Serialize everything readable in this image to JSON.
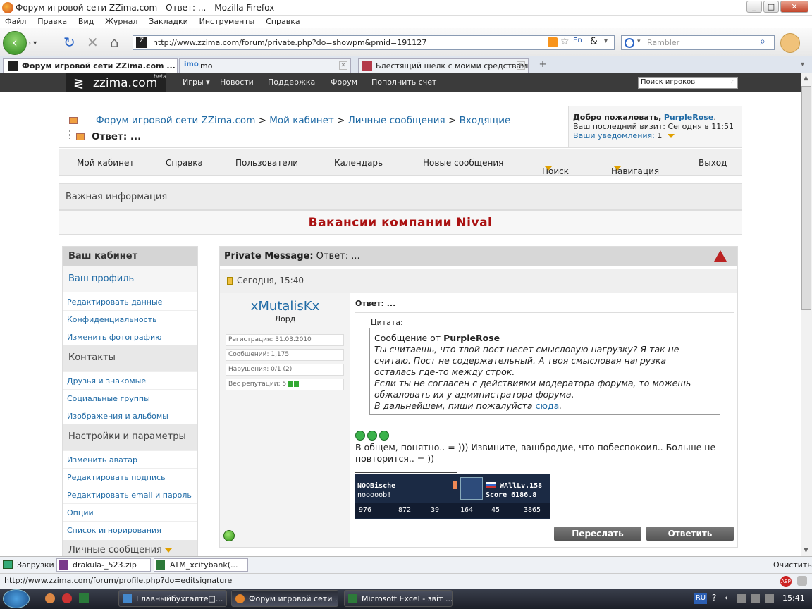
{
  "browser": {
    "title": "Форум игровой сети ZZima.com - Ответ: ... - Mozilla Firefox",
    "menu": [
      "Файл",
      "Правка",
      "Вид",
      "Журнал",
      "Закладки",
      "Инструменты",
      "Справка"
    ],
    "url": "http://www.zzima.com/forum/private.php?do=showpm&pmid=191127",
    "search_placeholder": "Rambler",
    "tabs": [
      {
        "label": "Форум игровой сети ZZima.com ..."
      },
      {
        "label": "imo"
      },
      {
        "label": "Блестящий шелк с моими средствами..."
      }
    ],
    "status_url": "http://www.zzima.com/forum/profile.php?do=editsignature"
  },
  "site": {
    "logo": "zzima.com",
    "logo_beta": "beta",
    "nav": [
      "Игры",
      "Новости",
      "Поддержка",
      "Форум",
      "Пополнить счет"
    ],
    "player_search": "Поиск игроков"
  },
  "breadcrumb": {
    "forum": "Форум игровой сети ZZima.com",
    "sep1": ">",
    "cabinet": "Мой кабинет",
    "sep2": ">",
    "pm": "Личные сообщения",
    "sep3": ">",
    "inbox": "Входящие",
    "current": "Ответ: ..."
  },
  "welcome": {
    "greeting": "Добро пожаловать,",
    "user": "PurpleRose",
    "dot": ".",
    "last_visit": "Ваш последний визит: Сегодня в 11:51",
    "notifications": "Ваши уведомления:",
    "notif_count": "1"
  },
  "topnav": [
    "Мой кабинет",
    "Справка",
    "Пользователи",
    "Календарь",
    "Новые сообщения",
    "Поиск",
    "Навигация",
    "Выход"
  ],
  "important_label": "Важная информация",
  "banner": "Вакансии компании Nival",
  "sidebar": {
    "title": "Ваш кабинет",
    "profile_header": "Ваш профиль",
    "profile_items": [
      "Редактировать данные",
      "Конфиденциальность",
      "Изменить фотографию"
    ],
    "contacts_header": "Контакты",
    "contacts_items": [
      "Друзья и знакомые",
      "Социальные группы",
      "Изображения и альбомы"
    ],
    "settings_header": "Настройки и параметры",
    "settings_items": [
      "Изменить аватар",
      "Редактировать подпись",
      "Редактировать email и пароль",
      "Опции",
      "Список игнорирования"
    ],
    "pm_header": "Личные сообщения"
  },
  "post": {
    "header_label": "Private Message:",
    "header_title": "Ответ: ...",
    "date": "Сегодня, 15:40",
    "author": "xMutalisKx",
    "rank": "Лорд",
    "stats": [
      "Регистрация: 31.03.2010",
      "Сообщений: 1,175",
      "Нарушения: 0/1 (2)",
      "Вес репутации: 5"
    ],
    "title": "Ответ: ...",
    "quote_label": "Цитата:",
    "quote_from": "Сообщение от",
    "quote_user": "PurpleRose",
    "quote_lines": [
      "Ты считаешь, что твой пост несет смысловую нагрузку? Я так не",
      "считаю. Пост не содержательный. А твоя смысловая нагрузка",
      "осталась где-то между строк.",
      "Если ты не согласен с действиями модератора форума, то можешь",
      "обжаловать их у администратора форума.",
      "В дальнейшем, пиши пожалуйста"
    ],
    "quote_link": "сюда",
    "quote_end": ".",
    "body_line1": "В общем, понятно.. = ))) Извините, вашбродие, что побеспокоил.. Больше не",
    "body_line2": "повторится.. = ))",
    "sig": {
      "name": "NOOBische",
      "sub": "nooooob!",
      "level": "WAllLv.158",
      "score": "Score 6186.8",
      "stats": [
        "976",
        "872",
        "39",
        "164",
        "45",
        "3865"
      ]
    },
    "forward_btn": "Переслать",
    "reply_btn": "Ответить"
  },
  "downloads": {
    "label": "Загрузки",
    "items": [
      "drakula-_523.zip",
      "ATM_xcitybank(..."
    ],
    "clear": "Очистить"
  },
  "taskbar": {
    "items": [
      "Главныйбухгалте□...",
      "Форум игровой сети ...",
      "Microsoft Excel - звіт ..."
    ],
    "lang": "RU",
    "time": "15:41"
  }
}
